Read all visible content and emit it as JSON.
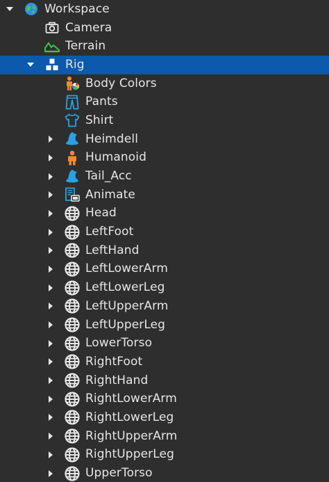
{
  "colors": {
    "background": "#2e2e2e",
    "selection": "#0b5aad",
    "text": "#e6e6e6",
    "part_icon": "#e8e8e8",
    "humanoid_orange": "#f08a2c",
    "clothing_blue": "#2aa1e0",
    "terrain_green": "#3fbf4a"
  },
  "tree": {
    "workspace": {
      "label": "Workspace",
      "icon": "workspace-globe-icon",
      "expanded": true
    },
    "camera": {
      "label": "Camera",
      "icon": "camera-icon"
    },
    "terrain": {
      "label": "Terrain",
      "icon": "terrain-icon"
    },
    "rig": {
      "label": "Rig",
      "icon": "model-icon",
      "expanded": true,
      "selected": true
    },
    "children": [
      {
        "label": "Body Colors",
        "icon": "body-colors-icon",
        "expandable": false
      },
      {
        "label": "Pants",
        "icon": "pants-icon",
        "expandable": false
      },
      {
        "label": "Shirt",
        "icon": "shirt-icon",
        "expandable": false
      },
      {
        "label": "Heimdell",
        "icon": "accessory-hat-icon",
        "expandable": true
      },
      {
        "label": "Humanoid",
        "icon": "humanoid-icon",
        "expandable": true
      },
      {
        "label": "Tail_Acc",
        "icon": "accessory-hat-icon",
        "expandable": true
      },
      {
        "label": "Animate",
        "icon": "script-icon",
        "expandable": true
      },
      {
        "label": "Head",
        "icon": "meshpart-icon",
        "expandable": true
      },
      {
        "label": "LeftFoot",
        "icon": "meshpart-icon",
        "expandable": true
      },
      {
        "label": "LeftHand",
        "icon": "meshpart-icon",
        "expandable": true
      },
      {
        "label": "LeftLowerArm",
        "icon": "meshpart-icon",
        "expandable": true
      },
      {
        "label": "LeftLowerLeg",
        "icon": "meshpart-icon",
        "expandable": true
      },
      {
        "label": "LeftUpperArm",
        "icon": "meshpart-icon",
        "expandable": true
      },
      {
        "label": "LeftUpperLeg",
        "icon": "meshpart-icon",
        "expandable": true
      },
      {
        "label": "LowerTorso",
        "icon": "meshpart-icon",
        "expandable": true
      },
      {
        "label": "RightFoot",
        "icon": "meshpart-icon",
        "expandable": true
      },
      {
        "label": "RightHand",
        "icon": "meshpart-icon",
        "expandable": true
      },
      {
        "label": "RightLowerArm",
        "icon": "meshpart-icon",
        "expandable": true
      },
      {
        "label": "RightLowerLeg",
        "icon": "meshpart-icon",
        "expandable": true
      },
      {
        "label": "RightUpperArm",
        "icon": "meshpart-icon",
        "expandable": true
      },
      {
        "label": "RightUpperLeg",
        "icon": "meshpart-icon",
        "expandable": true
      },
      {
        "label": "UpperTorso",
        "icon": "meshpart-icon",
        "expandable": true
      }
    ]
  }
}
